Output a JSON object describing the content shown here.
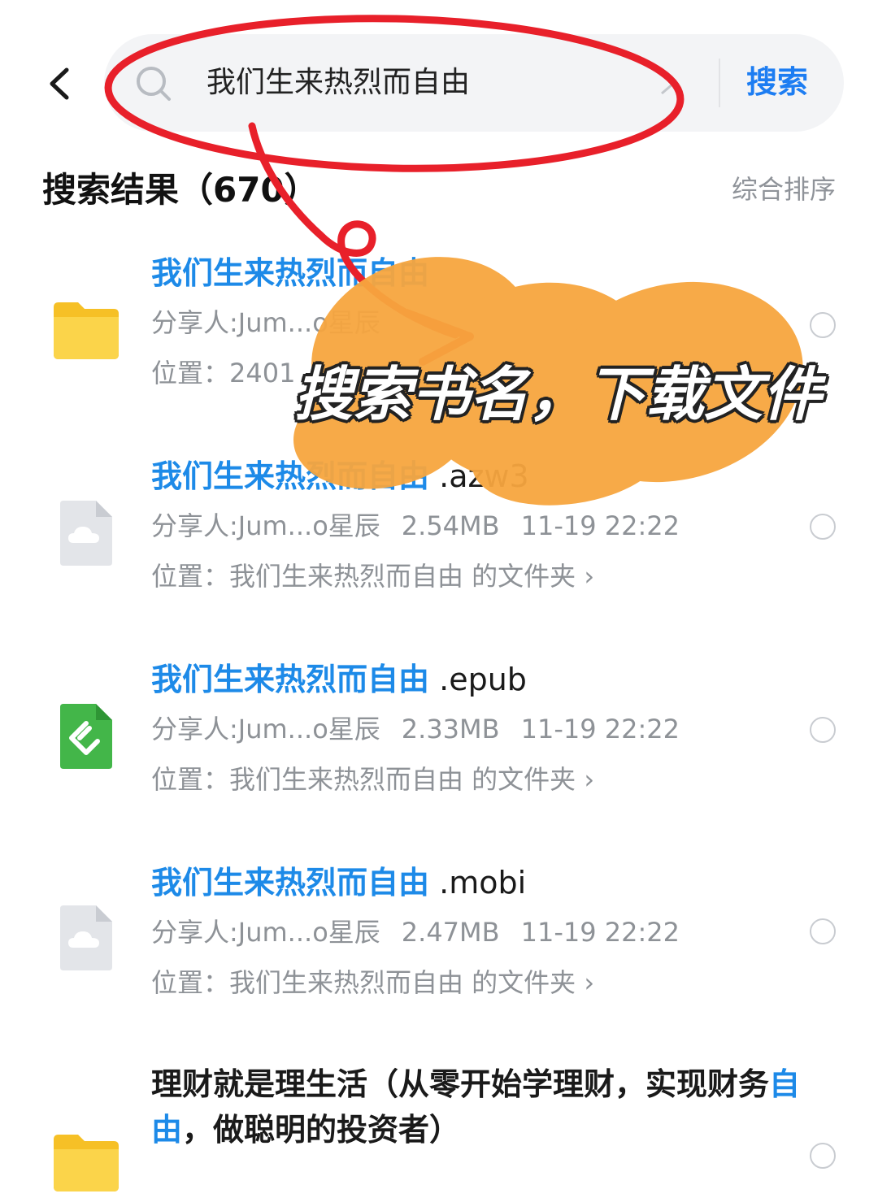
{
  "header": {
    "back_icon": "chevron-left-icon",
    "search_query": "我们生来热烈而自由",
    "search_button": "搜索"
  },
  "results": {
    "title": "搜索结果（670）",
    "sort_label": "综合排序",
    "items": [
      {
        "name_highlight": "我们生来热烈而自由",
        "name_rest": "",
        "meta": "分享人:Jum...o星辰",
        "location": "位置：2401",
        "icon": "folder-icon"
      },
      {
        "name_highlight": "我们生来热烈而自由",
        "name_rest": ".azw3",
        "sharer": "分享人:Jum...o星辰",
        "size": "2.54MB",
        "time": "11-19 22:22",
        "location": "位置：我们生来热烈而自由 的文件夹 ›",
        "icon": "cloud-file-icon"
      },
      {
        "name_highlight": "我们生来热烈而自由",
        "name_rest": ".epub",
        "sharer": "分享人:Jum...o星辰",
        "size": "2.33MB",
        "time": "11-19 22:22",
        "location": "位置：我们生来热烈而自由 的文件夹 ›",
        "icon": "epub-icon"
      },
      {
        "name_highlight": "我们生来热烈而自由",
        "name_rest": ".mobi",
        "sharer": "分享人:Jum...o星辰",
        "size": "2.47MB",
        "time": "11-19 22:22",
        "location": "位置：我们生来热烈而自由 的文件夹 ›",
        "icon": "cloud-file-icon"
      },
      {
        "name_before": "理财就是理生活（从零开始学理财，实现财务",
        "name_highlight": "自由",
        "name_after": "，做聪明的投资者）",
        "icon": "folder-icon"
      }
    ]
  },
  "annotation": {
    "caption": "搜索书名，下载文件",
    "colors": {
      "circle": "#e8202a",
      "brush": "#f7a63f"
    }
  }
}
